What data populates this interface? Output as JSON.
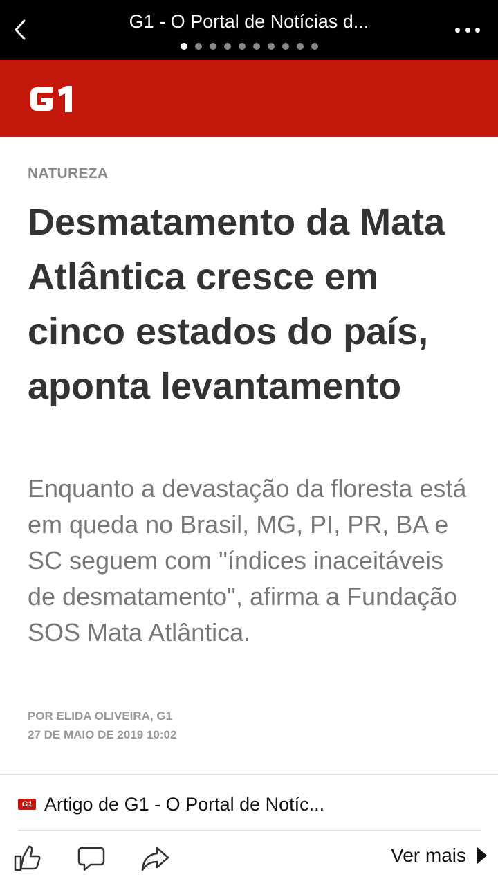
{
  "window": {
    "title": "G1 - O Portal de Notícias d...",
    "page_count": 10,
    "active_page": 1
  },
  "brand": {
    "logo_text": "G1",
    "color": "#c4170c"
  },
  "article": {
    "category": "NATUREZA",
    "headline": "Desmatamento da Mata Atlântica cresce em cinco estados do país, aponta levantamento",
    "subtitle": "Enquanto a devastação da floresta está em queda no Brasil, MG, PI, PR, BA e SC seguem com \"índices inaceitáveis de desmatamento\", afirma a Fundação SOS Mata Atlântica.",
    "author": "POR ELIDA OLIVEIRA, G1",
    "date": "27 DE MAIO DE 2019 10:02"
  },
  "attribution": {
    "logo_text": "G1",
    "text": "Artigo de G1 - O Portal de Notíc..."
  },
  "actions": {
    "like_icon": "thumbs-up-icon",
    "comment_icon": "comment-icon",
    "share_icon": "share-icon",
    "see_more_label": "Ver mais"
  }
}
